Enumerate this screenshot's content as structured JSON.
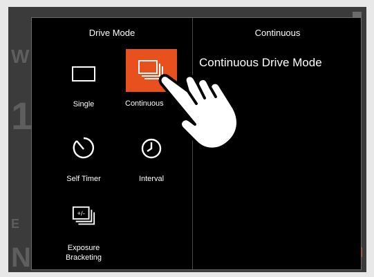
{
  "panel": {
    "drive_mode_title": "Drive Mode",
    "selected_title": "Continuous",
    "selected_description": "Continuous Drive Mode"
  },
  "items": [
    {
      "label": "Single",
      "icon": "single-frame-icon",
      "selected": false
    },
    {
      "label": "Continuous",
      "icon": "continuous-frames-icon",
      "selected": true
    },
    {
      "label": "Self Timer",
      "icon": "self-timer-icon",
      "selected": false
    },
    {
      "label": "Interval",
      "icon": "interval-clock-icon",
      "selected": false
    },
    {
      "label": "Exposure\nBracketing",
      "icon": "exposure-bracketing-icon",
      "selected": false
    }
  ],
  "colors": {
    "accent": "#e8501e",
    "panel_bg": "#000000",
    "screen_bg": "#3b3b3b",
    "frame_bg": "#e8e8e8"
  }
}
